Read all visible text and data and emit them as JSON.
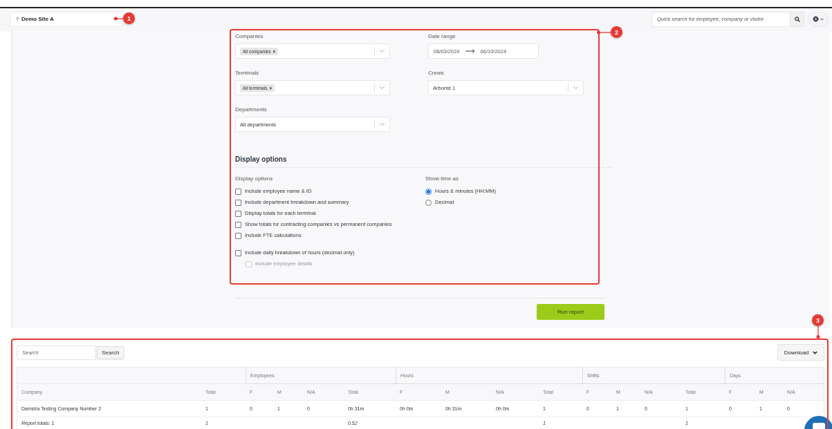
{
  "site_selector": {
    "value": "Demo Site A"
  },
  "quick_search": {
    "placeholder": "Quick search for employee, company or visitor"
  },
  "filters": {
    "companies": {
      "label": "Companies",
      "tag": "All companies",
      "remove": "×"
    },
    "date_range": {
      "label": "Date range",
      "start": "06/03/2024",
      "end": "06/10/2024"
    },
    "terminals": {
      "label": "Terminals",
      "tag": "All terminals",
      "remove": "×"
    },
    "crews": {
      "label": "Crews",
      "value": "Arborist 1"
    },
    "departments": {
      "label": "Departments",
      "value": "All departments"
    }
  },
  "display_options": {
    "heading": "Display options",
    "options_label": "Display options",
    "options": [
      {
        "label": "Include employee name & ID",
        "checked": false,
        "disabled": false
      },
      {
        "label": "Include department breakdown and summary",
        "checked": false,
        "disabled": false
      },
      {
        "label": "Display totals for each terminal",
        "checked": false,
        "disabled": false
      },
      {
        "label": "Show totals for contracting companies vs permanent companies",
        "checked": false,
        "disabled": false
      },
      {
        "label": "Include FTE calculations",
        "checked": false,
        "disabled": false
      },
      {
        "label": "Include daily breakdown of hours (decimal only)",
        "checked": false,
        "disabled": false,
        "children": [
          {
            "label": "Include employee details",
            "checked": false,
            "disabled": true
          }
        ]
      }
    ],
    "time_label": "Show time as",
    "time_formats": [
      {
        "label": "Hours & minutes (HH:MM)",
        "selected": true
      },
      {
        "label": "Decimal",
        "selected": false
      }
    ]
  },
  "run_button": "Run report",
  "results": {
    "search": {
      "placeholder": "Search",
      "button": "Search"
    },
    "download": "Download",
    "table": {
      "leading_columns": [
        "Company",
        "Total"
      ],
      "groups": [
        {
          "label": "Employees",
          "columns": [
            "F",
            "M",
            "N/A",
            "Total"
          ]
        },
        {
          "label": "Hours",
          "columns": [
            "F",
            "M",
            "N/A",
            "Total"
          ]
        },
        {
          "label": "Shifts",
          "columns": [
            "F",
            "M",
            "N/A",
            "Total"
          ]
        },
        {
          "label": "Days",
          "columns": [
            "F",
            "M",
            "N/A"
          ]
        }
      ],
      "rows": [
        [
          "Damstra Testing Company Number 2",
          "1",
          "0",
          "1",
          "0",
          "0h 31m",
          "0h 0m",
          "0h 31m",
          "0h 0m",
          "1",
          "0",
          "1",
          "0",
          "1",
          "0",
          "1",
          "0"
        ]
      ],
      "totals": {
        "company": "Report totals: 1",
        "total": "1",
        "employees_total": "0.52",
        "hours_total": "1",
        "shifts_total": "1"
      }
    }
  },
  "annotations": [
    {
      "label": "1"
    },
    {
      "label": "2"
    },
    {
      "label": "3"
    }
  ]
}
